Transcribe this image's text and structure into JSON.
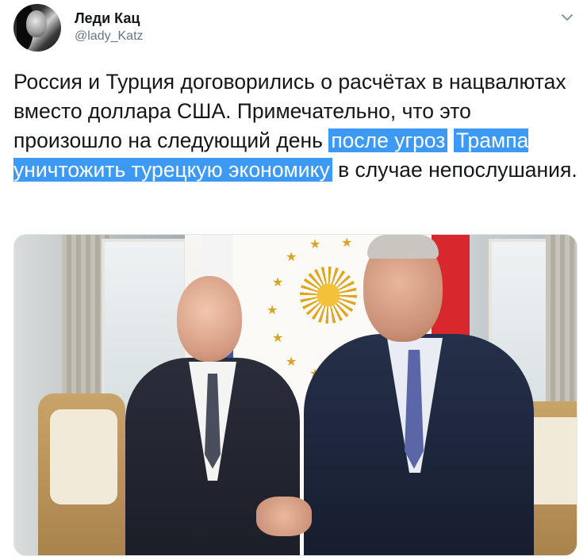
{
  "author": {
    "name": "Леди Кац",
    "handle": "@lady_Katz"
  },
  "icons": {
    "menu": "chevron-down-icon"
  },
  "tweet": {
    "text_1": "Россия и Турция договорились о расчётах в нацвалютах вместо доллара США. Примечательно, что это произошло на следующий день ",
    "highlight_1": "после угроз",
    "text_2": " ",
    "highlight_2": "Трампа уничтожить турецкую экономику",
    "text_3": " в случае непослушания."
  },
  "colors": {
    "highlight": "#3c99f4",
    "text": "#14171a",
    "secondary": "#657786"
  }
}
